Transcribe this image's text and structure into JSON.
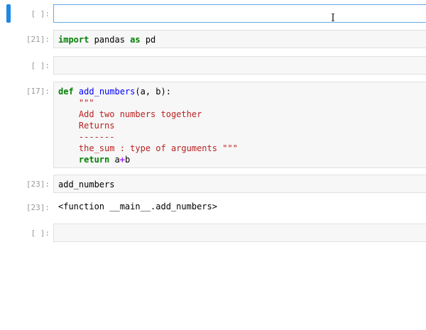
{
  "cells": [
    {
      "prompt": "[ ]:",
      "code": ""
    },
    {
      "prompt": "[21]:",
      "kw1": "import",
      "t1": " pandas ",
      "kw2": "as",
      "t2": " pd"
    },
    {
      "prompt": "[ ]:",
      "code": ""
    },
    {
      "prompt": "[17]:",
      "def": "def",
      "fname": "add_numbers",
      "sig": "(a, b):",
      "doc": [
        "    \"\"\"",
        "    Add two numbers together",
        "    Returns",
        "    -------",
        "    the_sum : type of arguments \"\"\""
      ],
      "ret_indent": "    ",
      "ret": "return",
      "ret_a": " a",
      "plus": "+",
      "ret_b": "b"
    },
    {
      "prompt": "[23]:",
      "code": "add_numbers",
      "out_prompt": "[23]:",
      "output": "<function __main__.add_numbers>"
    },
    {
      "prompt": "[ ]:",
      "code": ""
    }
  ],
  "cursor_glyph": "I",
  "active_color": "#1e88e5"
}
